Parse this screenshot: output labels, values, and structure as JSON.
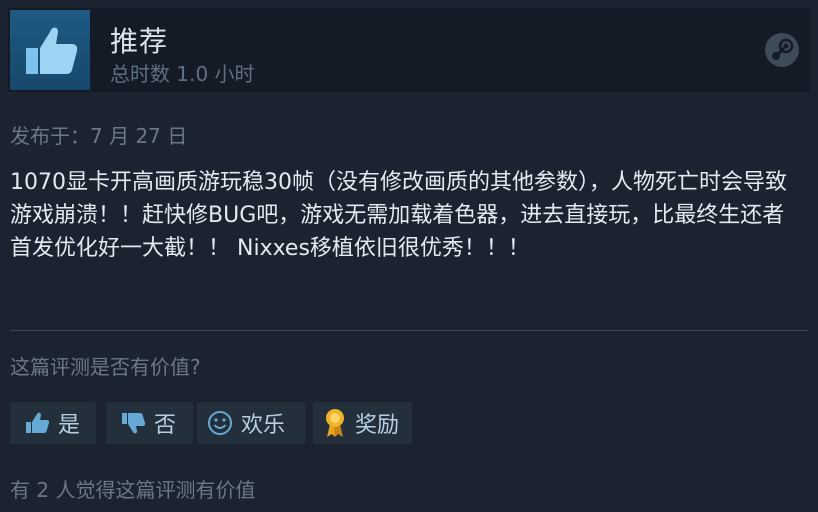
{
  "review": {
    "recommendation": "推荐",
    "hours": "总时数 1.0 小时",
    "posted": "发布于：7 月 27 日",
    "text": "1070显卡开高画质游玩稳30帧（没有修改画质的其他参数），人物死亡时会导致游戏崩溃！！赶快修BUG吧，游戏无需加载着色器，进去直接玩，比最终生还者首发优化好一大截！！ Nixxes移植依旧很优秀！！！"
  },
  "helpful": {
    "question": "这篇评测是否有价值?",
    "buttons": {
      "yes": "是",
      "no": "否",
      "funny": "欢乐",
      "award": "奖励"
    },
    "count_text": "有 2 人觉得这篇评测有价值"
  },
  "icons": {
    "recommend": "thumbs-up-icon",
    "platform": "steam-logo-icon",
    "yes": "thumbs-up-icon",
    "no": "thumbs-down-icon",
    "funny": "smiley-icon",
    "award": "award-ribbon-icon"
  },
  "colors": {
    "background": "#1b2230",
    "header_bg": "#141b26",
    "thumb_box": "#1e5a84",
    "button_bg": "#242f3c",
    "button_text": "#b7cfe2",
    "award_gold": "#f0b429"
  }
}
